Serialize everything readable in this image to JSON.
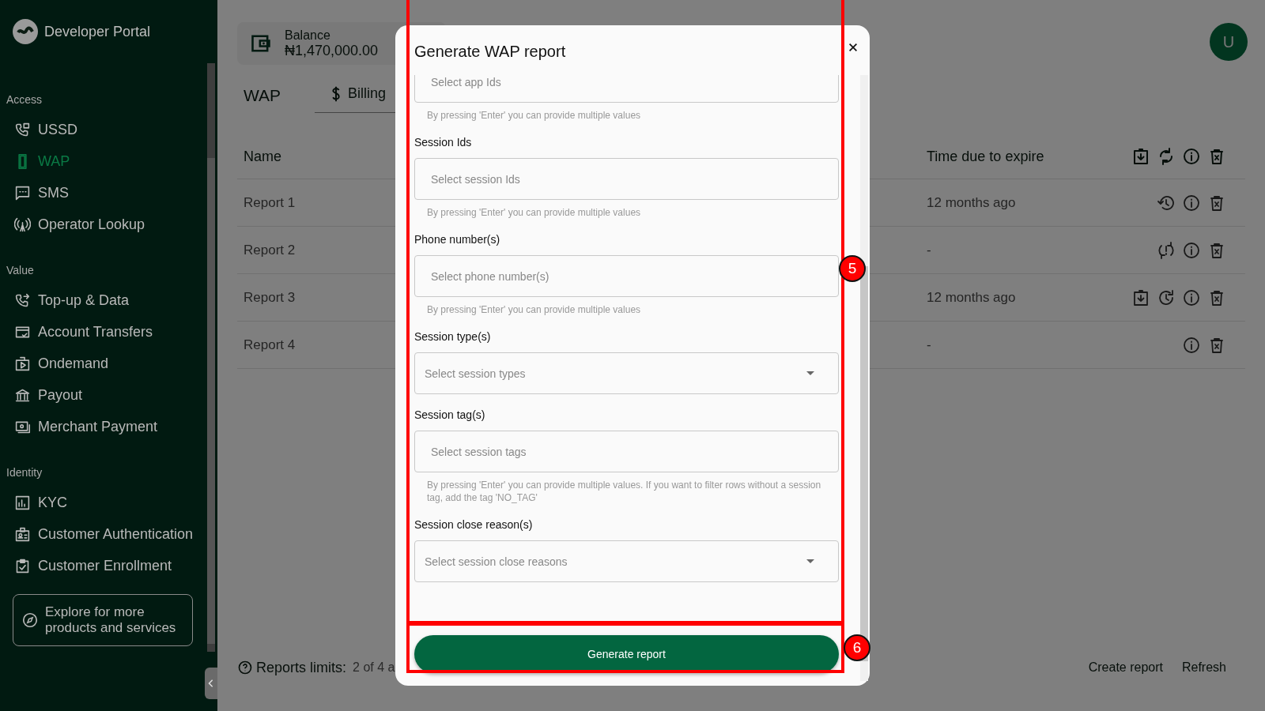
{
  "sidebar": {
    "title": "Developer Portal",
    "groups": [
      {
        "heading": "Access",
        "items": [
          {
            "label": "USSD",
            "kind": "ussd",
            "selected": false
          },
          {
            "label": "WAP",
            "kind": "phone",
            "selected": true
          },
          {
            "label": "SMS",
            "kind": "sms",
            "selected": false
          },
          {
            "label": "Operator Lookup",
            "kind": "antenna",
            "selected": false
          }
        ]
      },
      {
        "heading": "Value",
        "items": [
          {
            "label": "Top-up & Data",
            "kind": "topup",
            "selected": false
          },
          {
            "label": "Account Transfers",
            "kind": "card",
            "selected": false
          },
          {
            "label": "Ondemand",
            "kind": "play",
            "selected": false
          },
          {
            "label": "Payout",
            "kind": "bank",
            "selected": false
          },
          {
            "label": "Merchant Payment",
            "kind": "cash",
            "selected": false
          }
        ]
      },
      {
        "heading": "Identity",
        "items": [
          {
            "label": "KYC",
            "kind": "chart",
            "selected": false
          },
          {
            "label": "Customer Authentication",
            "kind": "badge",
            "selected": false
          },
          {
            "label": "Customer Enrollment",
            "kind": "check",
            "selected": false
          }
        ]
      }
    ],
    "explore": "Explore for more products and services"
  },
  "balance": {
    "label": "Balance",
    "amount": "₦1,470,000.00"
  },
  "page": {
    "title": "WAP",
    "tabs": [
      {
        "label": "Billing",
        "selected": false
      }
    ]
  },
  "avatar": "U",
  "table": {
    "columns": [
      "Name",
      "Time due to expire"
    ],
    "header_actions": [
      {
        "kind": "download"
      },
      {
        "kind": "sync"
      },
      {
        "kind": "info"
      },
      {
        "kind": "delete"
      }
    ],
    "rows": [
      {
        "name": "Report 1",
        "expires": "12 months ago",
        "actions": [
          {
            "kind": "history"
          },
          {
            "kind": "info"
          },
          {
            "kind": "delete"
          }
        ]
      },
      {
        "name": "Report 2",
        "expires": "-",
        "actions": [
          {
            "kind": "sync-problem"
          },
          {
            "kind": "info"
          },
          {
            "kind": "delete"
          }
        ]
      },
      {
        "name": "Report 3",
        "expires": "12 months ago",
        "actions": [
          {
            "kind": "download"
          },
          {
            "kind": "refresh"
          },
          {
            "kind": "info"
          },
          {
            "kind": "delete"
          }
        ]
      },
      {
        "name": "Report 4",
        "expires": "-",
        "actions": [
          {
            "kind": "info"
          },
          {
            "kind": "delete"
          }
        ]
      }
    ]
  },
  "footer": {
    "limits_label": "Reports limits:",
    "limits_value": "2 of 4 a",
    "links": [
      "Create report",
      "Refresh"
    ]
  },
  "dialog": {
    "title": "Generate WAP report",
    "fields": [
      {
        "kind": "text",
        "placeholder": "Select app Ids",
        "helper": "By pressing 'Enter' you can provide multiple values"
      },
      {
        "kind": "text",
        "label": "Session Ids",
        "placeholder": "Select session Ids",
        "helper": "By pressing 'Enter' you can provide multiple values"
      },
      {
        "kind": "text",
        "label": "Phone number(s)",
        "placeholder": "Select phone number(s)",
        "helper": "By pressing 'Enter' you can provide multiple values"
      },
      {
        "kind": "select",
        "label": "Session type(s)",
        "placeholder": "Select session types"
      },
      {
        "kind": "text",
        "label": "Session tag(s)",
        "placeholder": "Select session tags",
        "helper": "By pressing 'Enter' you can provide multiple values. If you want to filter rows without a session tag, add the tag 'NO_TAG'"
      },
      {
        "kind": "select",
        "label": "Session close reason(s)",
        "placeholder": "Select session close reasons"
      }
    ],
    "button": "Generate report"
  },
  "annotations": [
    {
      "label": "5"
    },
    {
      "label": "6"
    }
  ]
}
